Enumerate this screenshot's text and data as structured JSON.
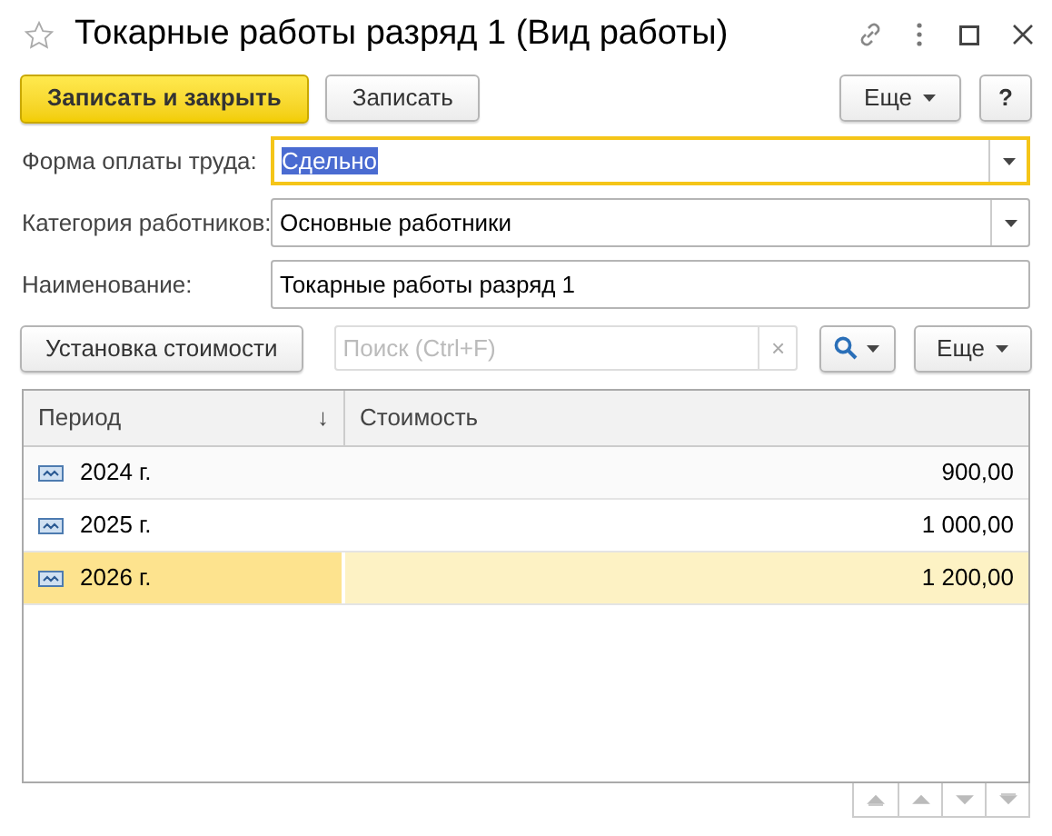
{
  "window": {
    "title": "Токарные работы разряд 1 (Вид работы)"
  },
  "commands": {
    "primary": "Записать и закрыть",
    "save": "Записать",
    "more": "Еще",
    "help": "?"
  },
  "fields": [
    {
      "label": "Форма оплаты труда:",
      "value": "Сдельно",
      "kind": "dropdown",
      "focused": true
    },
    {
      "label": "Категория работников:",
      "value": "Основные работники",
      "kind": "dropdown",
      "focused": false
    },
    {
      "label": "Наименование:",
      "value": "Токарные работы разряд 1",
      "kind": "text",
      "focused": false
    }
  ],
  "table_toolbar": {
    "button": "Установка стоимости",
    "search": {
      "placeholder": "Поиск (Ctrl+F)"
    },
    "clear": "×",
    "more": "Еще"
  },
  "table": {
    "columns": [
      {
        "label": "Период",
        "sort": "↓"
      },
      {
        "label": "Стоимость"
      }
    ],
    "rows": [
      {
        "period": "2024 г.",
        "cost": "900,00",
        "selected": false
      },
      {
        "period": "2025 г.",
        "cost": "1 000,00",
        "selected": false
      },
      {
        "period": "2026 г.",
        "cost": "1 200,00",
        "selected": true
      }
    ]
  }
}
